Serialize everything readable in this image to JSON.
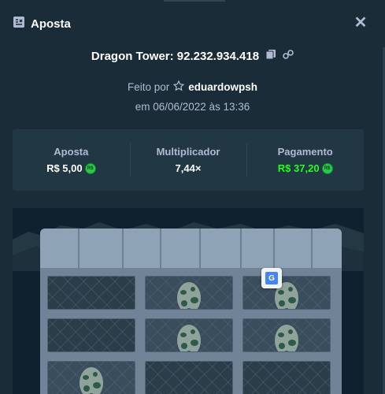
{
  "header": {
    "title": "Aposta",
    "icon": "bet-slip-icon",
    "close_icon": "close-icon"
  },
  "game": {
    "title": "Dragon Tower: 92.232.934.418",
    "made_by_prefix": "Feito por",
    "username": "eduardowpsh",
    "date": "em 06/06/2022 às 13:36"
  },
  "stats": [
    {
      "label": "Aposta",
      "value": "R$ 5,00",
      "currency_icon": true,
      "color": "#ffffff"
    },
    {
      "label": "Multiplicador",
      "value": "7,44×",
      "currency_icon": false,
      "color": "#ffffff"
    },
    {
      "label": "Pagamento",
      "value": "R$ 37,20",
      "currency_icon": true,
      "color": "#1fff20"
    }
  ],
  "currency_symbol": "R$",
  "board": {
    "rows": [
      [
        "empty",
        "egg",
        "egg"
      ],
      [
        "empty",
        "egg",
        "egg"
      ],
      [
        "egg",
        "empty",
        "empty"
      ]
    ]
  },
  "colors": {
    "background": "#1a2c38",
    "panel": "#213743",
    "text_muted": "#b1bad3",
    "accent_green": "#1fff20"
  }
}
